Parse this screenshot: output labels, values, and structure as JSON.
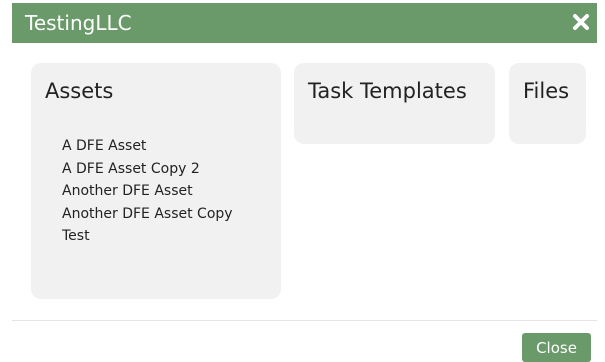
{
  "dialog": {
    "title": "TestingLLC",
    "close_icon": "close-icon",
    "close_button_label": "Close"
  },
  "panels": {
    "assets": {
      "title": "Assets",
      "items": [
        "A DFE Asset",
        "A DFE Asset Copy 2",
        "Another DFE Asset",
        "Another DFE Asset Copy",
        "Test"
      ]
    },
    "task_templates": {
      "title": "Task Templates"
    },
    "files": {
      "title": "Files"
    }
  },
  "colors": {
    "header": "#6a9a69",
    "panel_bg": "#f1f1f1",
    "button": "#6a9a69"
  }
}
